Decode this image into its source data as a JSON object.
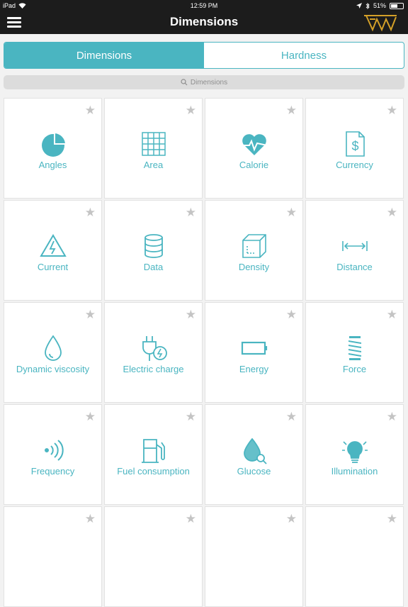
{
  "status": {
    "device": "iPad",
    "time": "12:59 PM",
    "battery": "51%"
  },
  "nav": {
    "title": "Dimensions"
  },
  "tabs": [
    {
      "label": "Dimensions",
      "active": true
    },
    {
      "label": "Hardness",
      "active": false
    }
  ],
  "search": {
    "placeholder": "Dimensions"
  },
  "colors": {
    "accent": "#4ab5c1",
    "bar": "#1c1c1c",
    "logo": "#d4a028"
  },
  "tiles": [
    {
      "label": "Angles",
      "icon": "pie-chart-icon"
    },
    {
      "label": "Area",
      "icon": "grid-icon"
    },
    {
      "label": "Calorie",
      "icon": "heart-pulse-icon"
    },
    {
      "label": "Currency",
      "icon": "dollar-document-icon"
    },
    {
      "label": "Current",
      "icon": "high-voltage-icon"
    },
    {
      "label": "Data",
      "icon": "database-icon"
    },
    {
      "label": "Density",
      "icon": "cube-icon"
    },
    {
      "label": "Distance",
      "icon": "distance-arrows-icon"
    },
    {
      "label": "Dynamic viscosity",
      "icon": "drop-icon"
    },
    {
      "label": "Electric charge",
      "icon": "plug-icon"
    },
    {
      "label": "Energy",
      "icon": "battery-icon"
    },
    {
      "label": "Force",
      "icon": "spring-icon"
    },
    {
      "label": "Frequency",
      "icon": "waves-icon"
    },
    {
      "label": "Fuel consumption",
      "icon": "fuel-pump-icon"
    },
    {
      "label": "Glucose",
      "icon": "glucose-drop-icon"
    },
    {
      "label": "Illumination",
      "icon": "light-bulb-icon"
    },
    {
      "label": "",
      "icon": "partial-icon"
    },
    {
      "label": "",
      "icon": "partial-icon"
    },
    {
      "label": "",
      "icon": "partial-icon"
    },
    {
      "label": "",
      "icon": "partial-icon"
    }
  ]
}
